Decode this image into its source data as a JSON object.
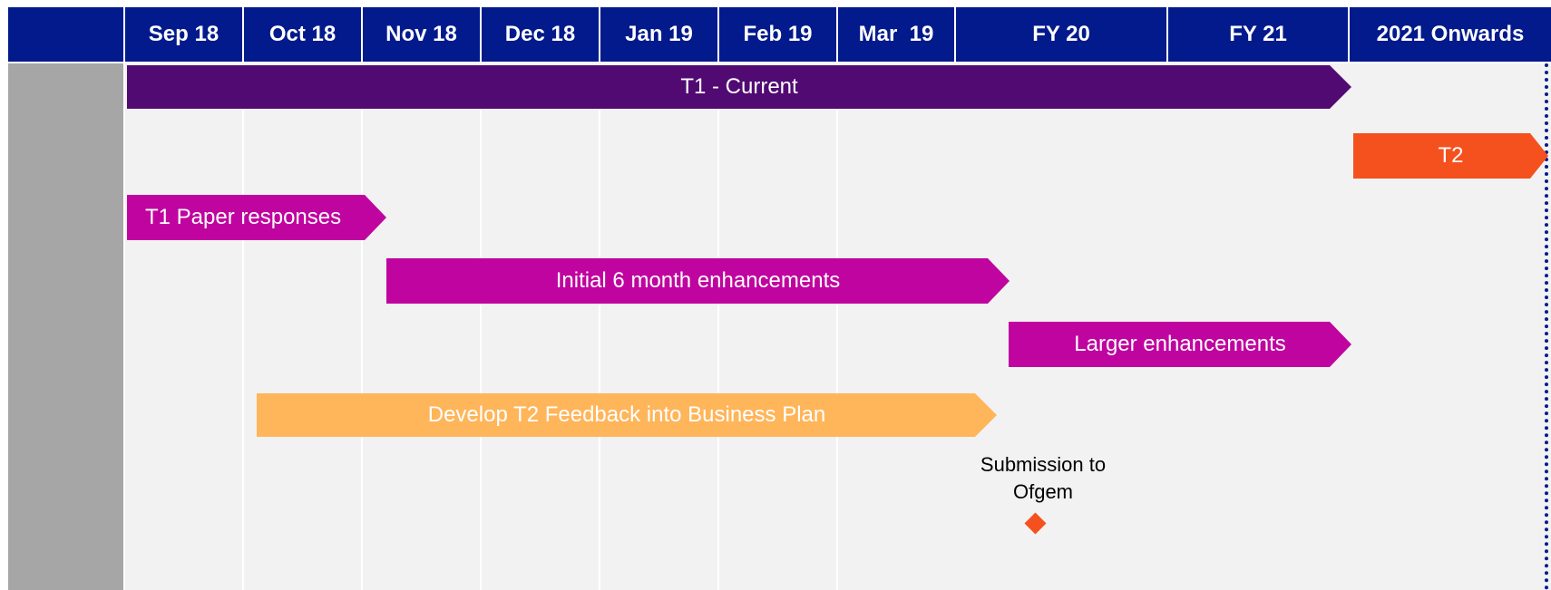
{
  "header": {
    "columns": [
      "Sep 18",
      "Oct 18",
      "Nov 18",
      "Dec 18",
      "Jan 19",
      "Feb 19",
      "Mar  19",
      "FY 20",
      "FY 21",
      "2021 Onwards"
    ]
  },
  "bars": [
    {
      "label": "T1 - Current",
      "color": "#520a73"
    },
    {
      "label": "T2",
      "color": "#f4511e"
    },
    {
      "label": "T1 Paper responses",
      "color": "#c0049f"
    },
    {
      "label": "Initial 6 month enhancements",
      "color": "#c0049f"
    },
    {
      "label": "Larger enhancements",
      "color": "#c0049f"
    },
    {
      "label": "Develop T2 Feedback into Business Plan",
      "color": "#ffb55a"
    }
  ],
  "milestone": {
    "label": "Submission to Ofgem",
    "color": "#f4511e"
  },
  "colors": {
    "header": "#021a8c",
    "background": "#f2f2f2",
    "side_panel": "#a6a6a6"
  }
}
